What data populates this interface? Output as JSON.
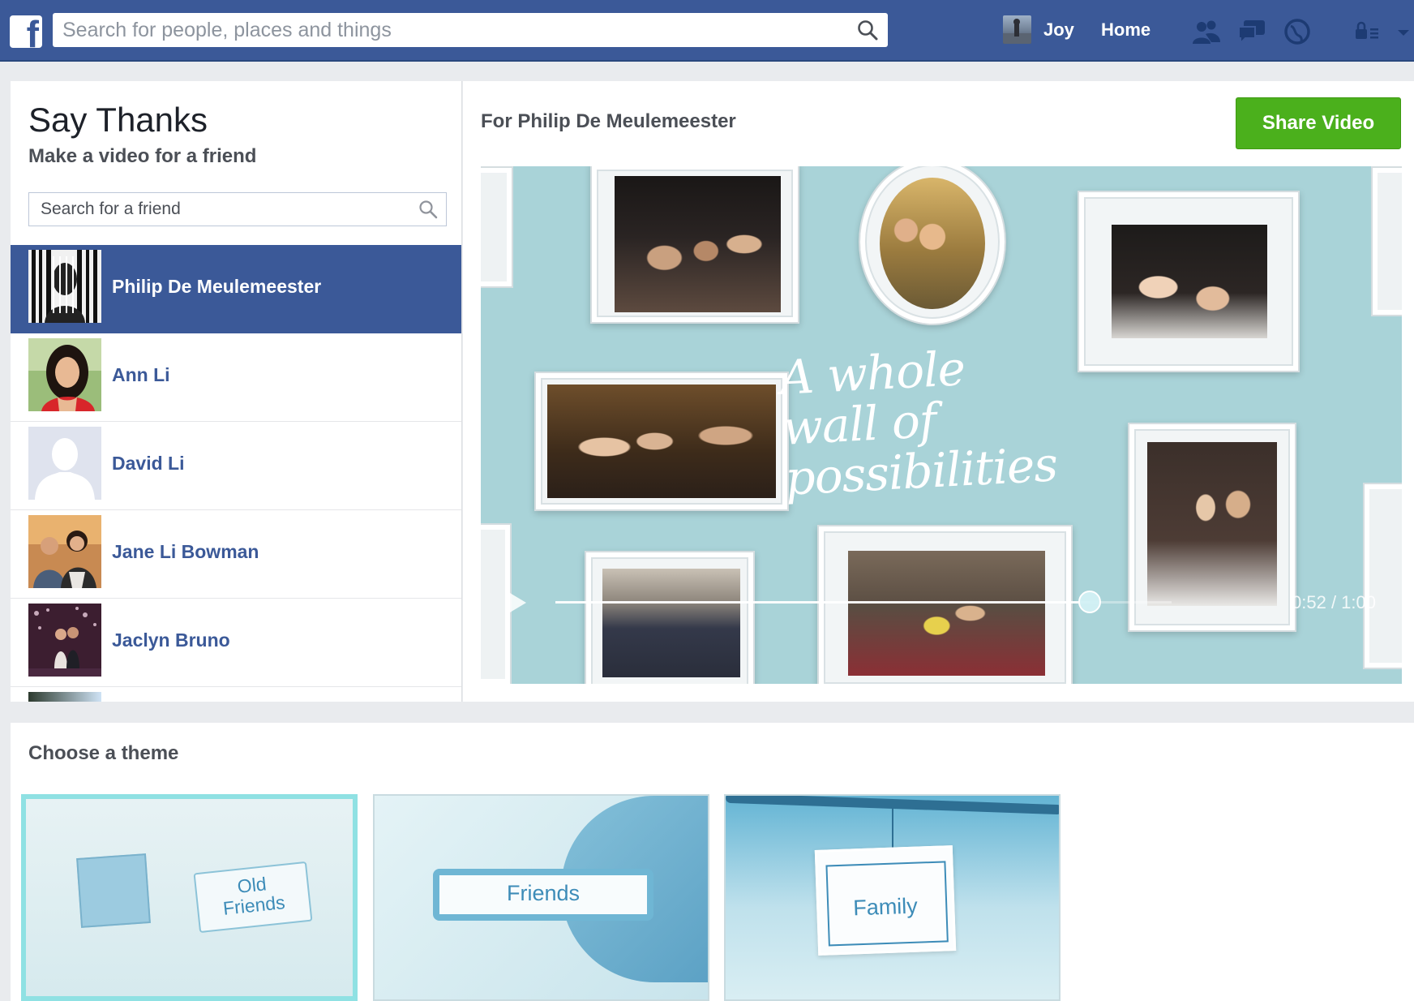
{
  "topbar": {
    "logo_letter": "f",
    "search_placeholder": "Search for people, places and things",
    "user_name": "Joy",
    "home_label": "Home",
    "icons": [
      "friend-requests-icon",
      "messages-icon",
      "notifications-icon",
      "privacy-icon",
      "account-menu-icon"
    ]
  },
  "left": {
    "title": "Say Thanks",
    "subtitle": "Make a video for a friend",
    "search_placeholder": "Search for a friend",
    "friends": [
      {
        "name": "Philip De Meulemeester",
        "selected": true
      },
      {
        "name": "Ann Li",
        "selected": false
      },
      {
        "name": "David Li",
        "selected": false
      },
      {
        "name": "Jane Li Bowman",
        "selected": false
      },
      {
        "name": "Jaclyn Bruno",
        "selected": false
      }
    ]
  },
  "right": {
    "for_label": "For Philip De Meulemeester",
    "share_label": "Share Video",
    "tagline": "A whole wall of possibilities",
    "player": {
      "time": "0:52 / 1:00",
      "progress": 0.867
    }
  },
  "themes": {
    "title": "Choose a theme",
    "items": [
      {
        "label_line1": "Old",
        "label_line2": "Friends",
        "selected": true
      },
      {
        "label": "Friends",
        "selected": false
      },
      {
        "label": "Family",
        "selected": false
      }
    ]
  },
  "colors": {
    "brand_blue": "#3b5998",
    "share_green": "#4bb01c",
    "video_bg": "#a9d3d8",
    "theme_selected": "#8fe1e3"
  }
}
